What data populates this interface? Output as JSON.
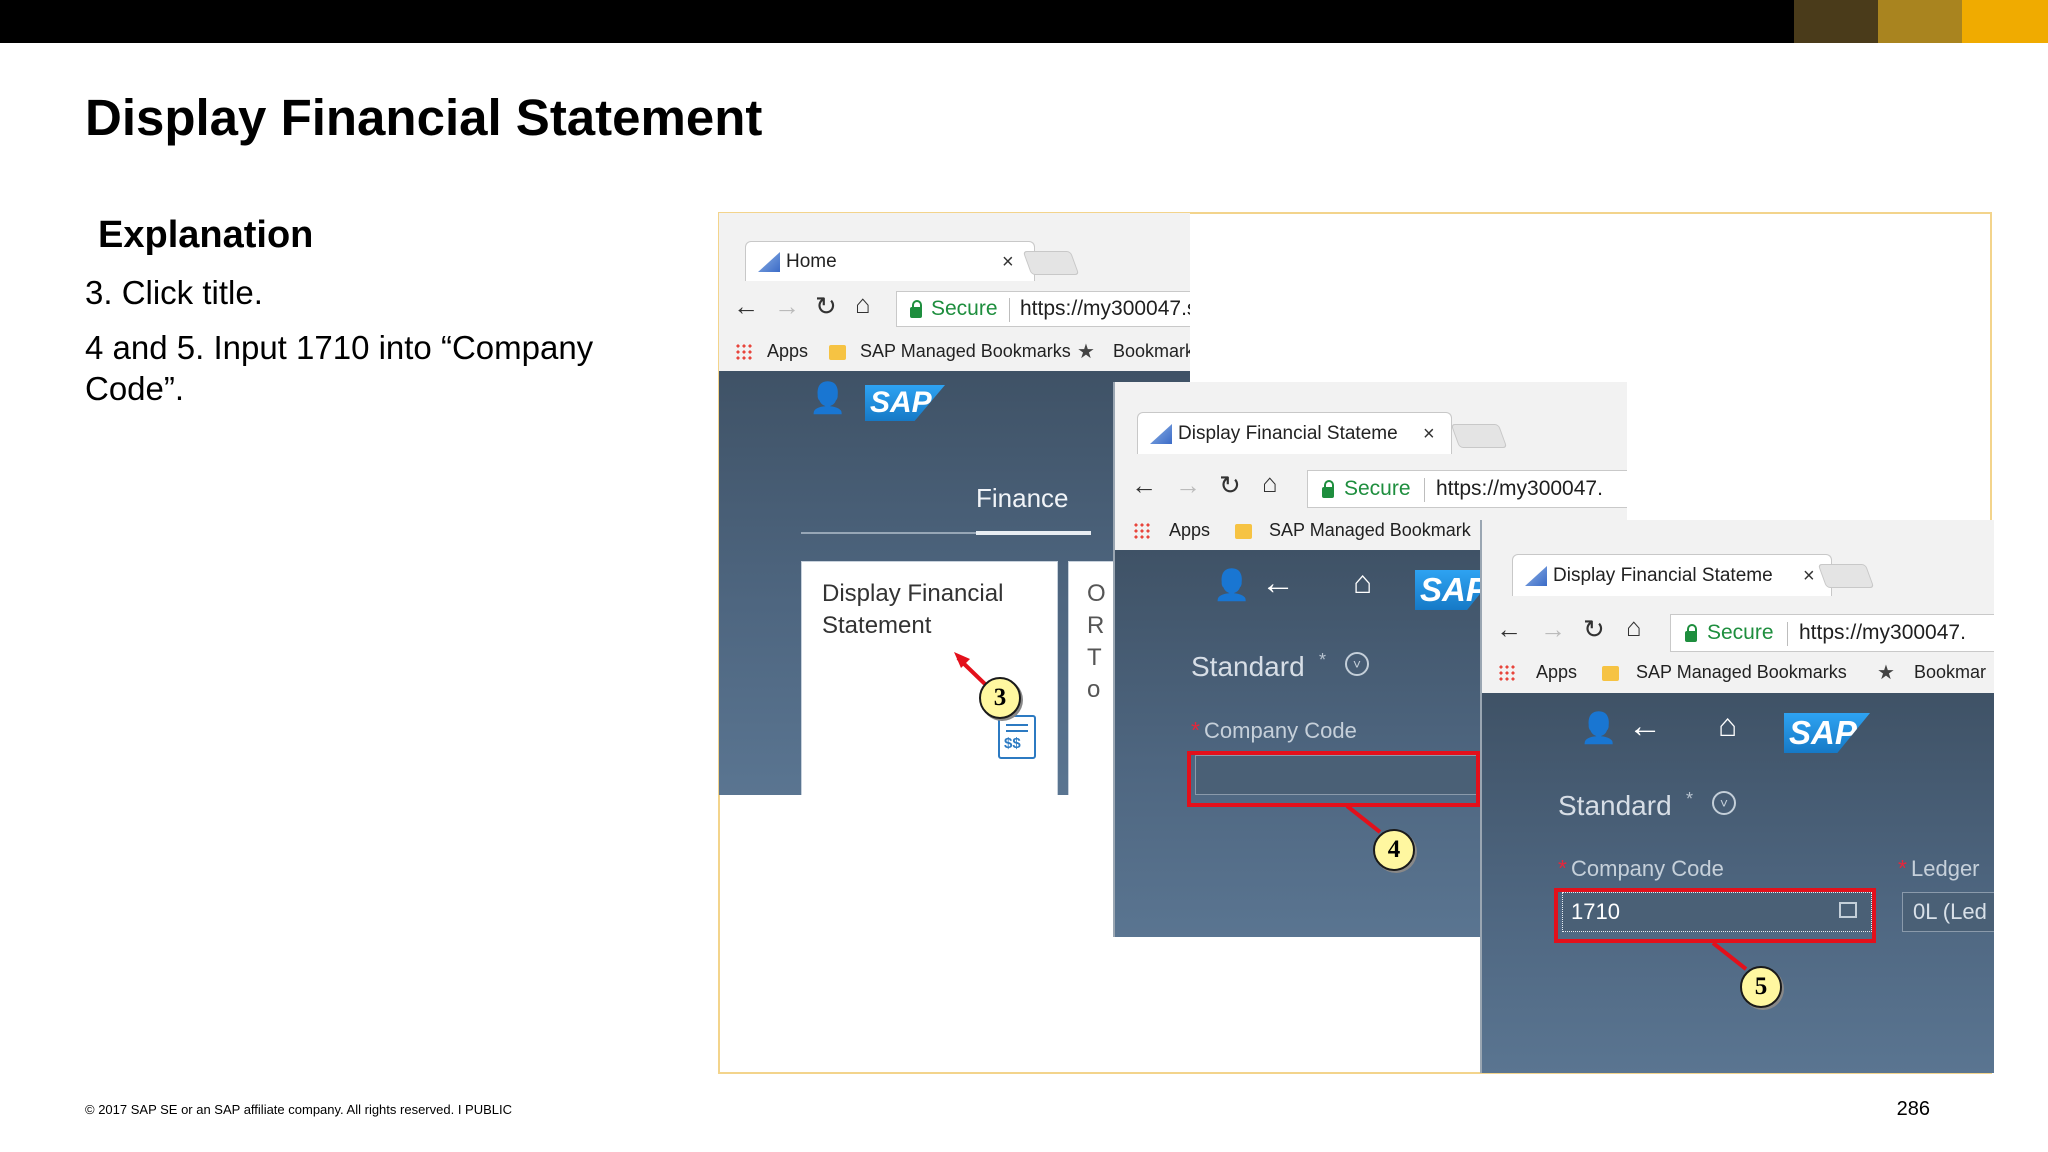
{
  "slide": {
    "title": "Display Financial Statement",
    "explanation_heading": "Explanation",
    "steps": [
      "3. Click title.",
      "4 and 5. Input 1710 into “Company Code”."
    ],
    "footer": "© 2017 SAP SE or an SAP affiliate company. All rights reserved.   I   PUBLIC",
    "page_number": "286",
    "brand_colors": [
      "#4a3b1a",
      "#a9841f",
      "#f0ab00"
    ]
  },
  "screen1": {
    "tab_title": "Home",
    "tab_close": "×",
    "secure_label": "Secure",
    "url": "https://my300047.s",
    "bookmarks": [
      "Apps",
      "SAP Managed Bookmarks",
      "Bookmark"
    ],
    "sap_logo": "SAP",
    "group_label": "Finance",
    "tile_title": "Display Financial Statement",
    "tile2_letters": "O R To",
    "tile_icon": "financial-statement-icon",
    "callout": "3"
  },
  "screen2": {
    "tab_title": "Display Financial Stateme",
    "tab_close": "×",
    "secure_label": "Secure",
    "url": "https://my300047.",
    "bookmarks": [
      "Apps",
      "SAP Managed Bookmark"
    ],
    "sap_logo": "SAP",
    "variant": "Standard",
    "field_label": "Company Code",
    "field_value": "",
    "callout": "4"
  },
  "screen3": {
    "tab_title": "Display Financial Stateme",
    "tab_close": "×",
    "secure_label": "Secure",
    "url": "https://my300047.",
    "bookmarks": [
      "Apps",
      "SAP Managed Bookmarks",
      "Bookmar"
    ],
    "sap_logo": "SAP",
    "variant": "Standard",
    "field_label": "Company Code",
    "field_value": "1710",
    "ledger_label": "Ledger",
    "ledger_value": "0L (Led",
    "callout": "5"
  }
}
